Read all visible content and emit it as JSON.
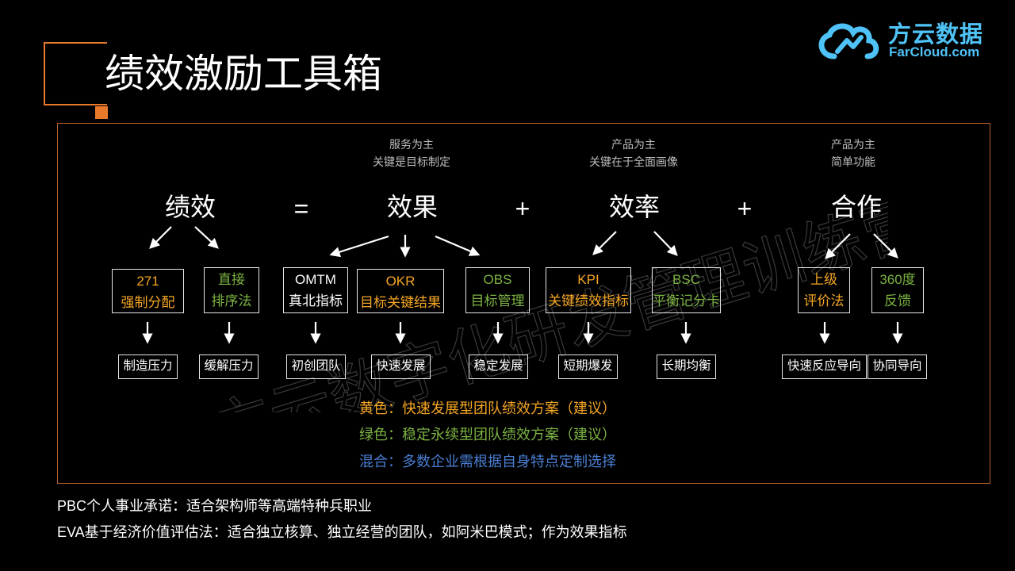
{
  "title": "绩效激励工具箱",
  "logo": {
    "cn": "方云数据",
    "en": "FarCloud.com",
    "color": "#4fc3f7"
  },
  "watermark": "方云数字化研发管理训练营",
  "accent": "#e8792b",
  "notes": {
    "effect": {
      "line1": "服务为主",
      "line2": "关键是目标制定"
    },
    "efficiency": {
      "line1": "产品为主",
      "line2": "关键在于全面画像"
    },
    "cooperation": {
      "line1": "产品为主",
      "line2": "简单功能"
    }
  },
  "equation": {
    "performance": "绩效",
    "equals": "=",
    "effect": "效果",
    "plus1": "+",
    "efficiency": "效率",
    "plus2": "+",
    "cooperation": "合作"
  },
  "tools": {
    "t271": {
      "line1": "271",
      "line2": "强制分配",
      "color": "yellow"
    },
    "direct": {
      "line1": "直接",
      "line2": "排序法",
      "color": "green"
    },
    "omtm": {
      "line1": "OMTM",
      "line2": "真北指标",
      "color": "white"
    },
    "okr": {
      "line1": "OKR",
      "line2": "目标关键结果",
      "color": "yellow"
    },
    "obs": {
      "line1": "OBS",
      "line2": "目标管理",
      "color": "green"
    },
    "kpi": {
      "line1": "KPI",
      "line2": "关键绩效指标",
      "color": "yellow"
    },
    "bsc": {
      "line1": "BSC",
      "line2": "平衡记分卡",
      "color": "green"
    },
    "superior": {
      "line1": "上级",
      "line2": "评价法",
      "color": "yellow"
    },
    "deg360": {
      "line1": "360度",
      "line2": "反馈",
      "color": "green"
    }
  },
  "results": {
    "t271": "制造压力",
    "direct": "缓解压力",
    "omtm": "初创团队",
    "okr": "快速发展",
    "obs": "稳定发展",
    "kpi": "短期爆发",
    "bsc": "长期均衡",
    "superior": "快速反应导向",
    "deg360": "协同导向"
  },
  "legend": {
    "yellow": "黄色：快速发展型团队绩效方案（建议）",
    "green": "绿色：稳定永续型团队绩效方案（建议）",
    "mixed": "混合：多数企业需根据自身特点定制选择"
  },
  "colors": {
    "yellow": "#f5a623",
    "green": "#7cb342",
    "blue": "#4a7fd4"
  },
  "footer": {
    "line1": "PBC个人事业承诺：适合架构师等高端特种兵职业",
    "line2": "EVA基于经济价值评估法：适合独立核算、独立经营的团队，如阿米巴模式；作为效果指标"
  }
}
